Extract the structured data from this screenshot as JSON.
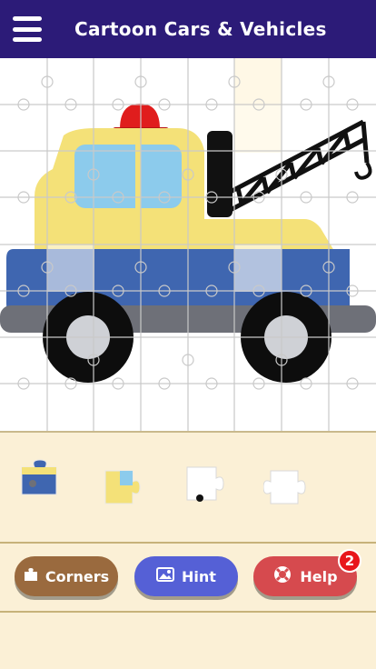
{
  "header": {
    "title": "Cartoon Cars & Vehicles",
    "menu_icon": "hamburger-menu-icon"
  },
  "puzzle": {
    "image_subject": "cartoon tow truck",
    "grid_cols": 8,
    "grid_rows": 8
  },
  "tray": {
    "pieces": [
      {
        "name": "tray-piece-1",
        "color": "#3f66b0"
      },
      {
        "name": "tray-piece-2",
        "color": "#f5e07a"
      },
      {
        "name": "tray-piece-3",
        "color": "#ffffff"
      },
      {
        "name": "tray-piece-4",
        "color": "#ffffff"
      }
    ]
  },
  "buttons": {
    "corners_label": "Corners",
    "hint_label": "Hint",
    "help_label": "Help",
    "help_badge": "2"
  },
  "colors": {
    "header_bg": "#2c1b78",
    "corners_bg": "#9a6a3e",
    "hint_bg": "#5560d6",
    "help_bg": "#d64a4e",
    "badge_bg": "#e8161b",
    "tray_bg": "#fbf0d6"
  }
}
